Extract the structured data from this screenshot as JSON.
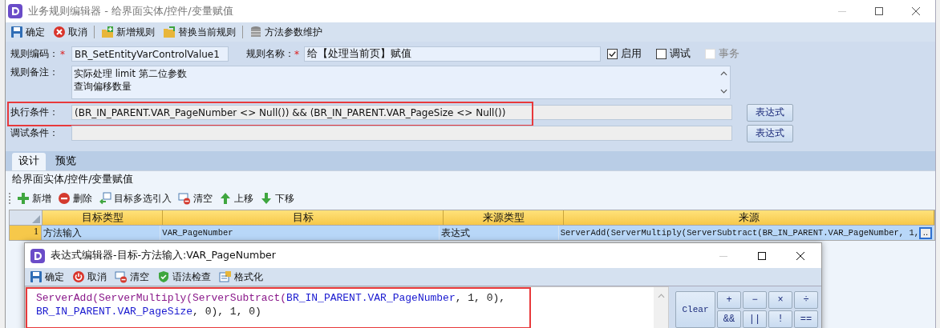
{
  "window": {
    "title": "业务规则编辑器 - 给界面实体/控件/变量赋值"
  },
  "toolbar": [
    {
      "label": "确定"
    },
    {
      "label": "取消"
    },
    {
      "label": "新增规则"
    },
    {
      "label": "替换当前规则"
    },
    {
      "label": "方法参数维护"
    }
  ],
  "form": {
    "rule_code": {
      "label": "规则编码：",
      "required_mark": "*",
      "value": "BR_SetEntityVarControlValue1"
    },
    "rule_name": {
      "label": "规则名称：",
      "required_mark": "*",
      "value": "给【处理当前页】赋值"
    },
    "options": [
      {
        "label": "启用",
        "checked": true,
        "disabled": false
      },
      {
        "label": "调试",
        "checked": false,
        "disabled": false
      },
      {
        "label": "事务",
        "checked": false,
        "disabled": true
      }
    ],
    "remark": {
      "label": "规则备注：",
      "lines": [
        "实际处理 limit 第二位参数",
        "查询偏移数量"
      ]
    },
    "condition": {
      "label": "执行条件：",
      "value": "(BR_IN_PARENT.VAR_PageNumber <> Null()) && (BR_IN_PARENT.VAR_PageSize <> Null())",
      "button": "表达式",
      "highlighted": true
    },
    "debug_condition": {
      "label": "调试条件：",
      "button": "表达式"
    }
  },
  "tabs": [
    {
      "label": "设计",
      "selected": true
    },
    {
      "label": "预览",
      "selected": false
    }
  ],
  "group_title": "给界面实体/控件/变量赋值",
  "grid_toolbar": [
    {
      "label": "新增"
    },
    {
      "label": "删除"
    },
    {
      "label": "目标多选引入"
    },
    {
      "label": "清空"
    },
    {
      "label": "上移"
    },
    {
      "label": "下移"
    }
  ],
  "grid": {
    "columns": [
      "目标类型",
      "目标",
      "来源类型",
      "来源"
    ],
    "rows": [
      {
        "number": "1",
        "cells": [
          "方法输入",
          "VAR_PageNumber",
          "表达式",
          "ServerAdd(ServerMultiply(ServerSubtract(BR_IN_PARENT.VAR_PageNumber, 1,"
        ],
        "selected": true
      }
    ],
    "cell_button": ".."
  },
  "dialog": {
    "title": "表达式编辑器-目标-方法输入:VAR_PageNumber",
    "toolbar": [
      {
        "label": "确定"
      },
      {
        "label": "取消"
      },
      {
        "label": "清空"
      },
      {
        "label": "语法检查"
      },
      {
        "label": "格式化"
      }
    ],
    "code": {
      "highlighted": true,
      "lines": [
        [
          {
            "text": "ServerAdd(",
            "kind": "function"
          },
          {
            "text": "ServerMultiply(",
            "kind": "function"
          },
          {
            "text": "ServerSubtract(",
            "kind": "function"
          },
          {
            "text": "BR_IN_PARENT.VAR_PageNumber",
            "kind": "variable"
          },
          {
            "text": ", 1, 0),",
            "kind": "plain"
          }
        ],
        [
          {
            "text": "BR_IN_PARENT.VAR_PageSize",
            "kind": "variable"
          },
          {
            "text": ", 0), 1, 0)",
            "kind": "plain"
          }
        ]
      ]
    },
    "keypad": [
      "Clear",
      "+",
      "−",
      "×",
      "÷",
      "&&",
      "||",
      "!",
      "=="
    ]
  }
}
